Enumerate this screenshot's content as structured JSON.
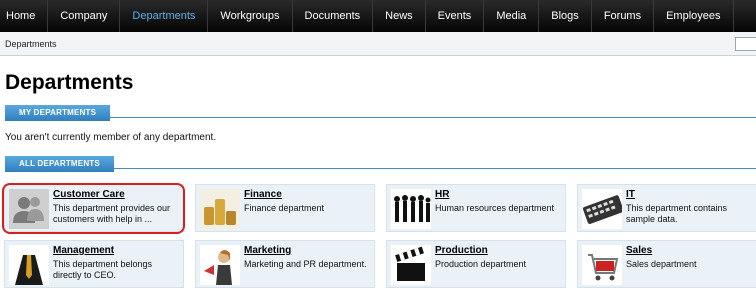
{
  "nav": {
    "items": [
      "Home",
      "Company",
      "Departments",
      "Workgroups",
      "Documents",
      "News",
      "Events",
      "Media",
      "Blogs",
      "Forums",
      "Employees"
    ],
    "active": "Departments"
  },
  "breadcrumb": "Departments",
  "page_title": "Departments",
  "my_departments": {
    "header": "MY DEPARTMENTS",
    "note": "You aren't currently member of any department."
  },
  "all_departments": {
    "header": "ALL DEPARTMENTS",
    "cards": [
      {
        "name": "Customer Care",
        "desc": "This department provides our customers with help in ...",
        "icon": "users-silhouette-icon"
      },
      {
        "name": "Finance",
        "desc": "Finance department",
        "icon": "coins-icon"
      },
      {
        "name": "HR",
        "desc": "Human resources department",
        "icon": "people-silhouettes-icon"
      },
      {
        "name": "IT",
        "desc": "This department contains sample data.",
        "icon": "keyboard-icon"
      },
      {
        "name": "Management",
        "desc": "This department belongs directly to CEO.",
        "icon": "businessman-icon"
      },
      {
        "name": "Marketing",
        "desc": "Marketing and PR department.",
        "icon": "woman-megaphone-icon"
      },
      {
        "name": "Production",
        "desc": "Production department",
        "icon": "clapperboard-icon"
      },
      {
        "name": "Sales",
        "desc": "Sales department",
        "icon": "shopping-cart-icon"
      }
    ]
  },
  "colors": {
    "nav_bg": "#050505",
    "nav_active": "#5db0e8",
    "section_tab": "#3f8fc5",
    "card_bg": "#eaf2f8",
    "highlight": "#d62020"
  }
}
